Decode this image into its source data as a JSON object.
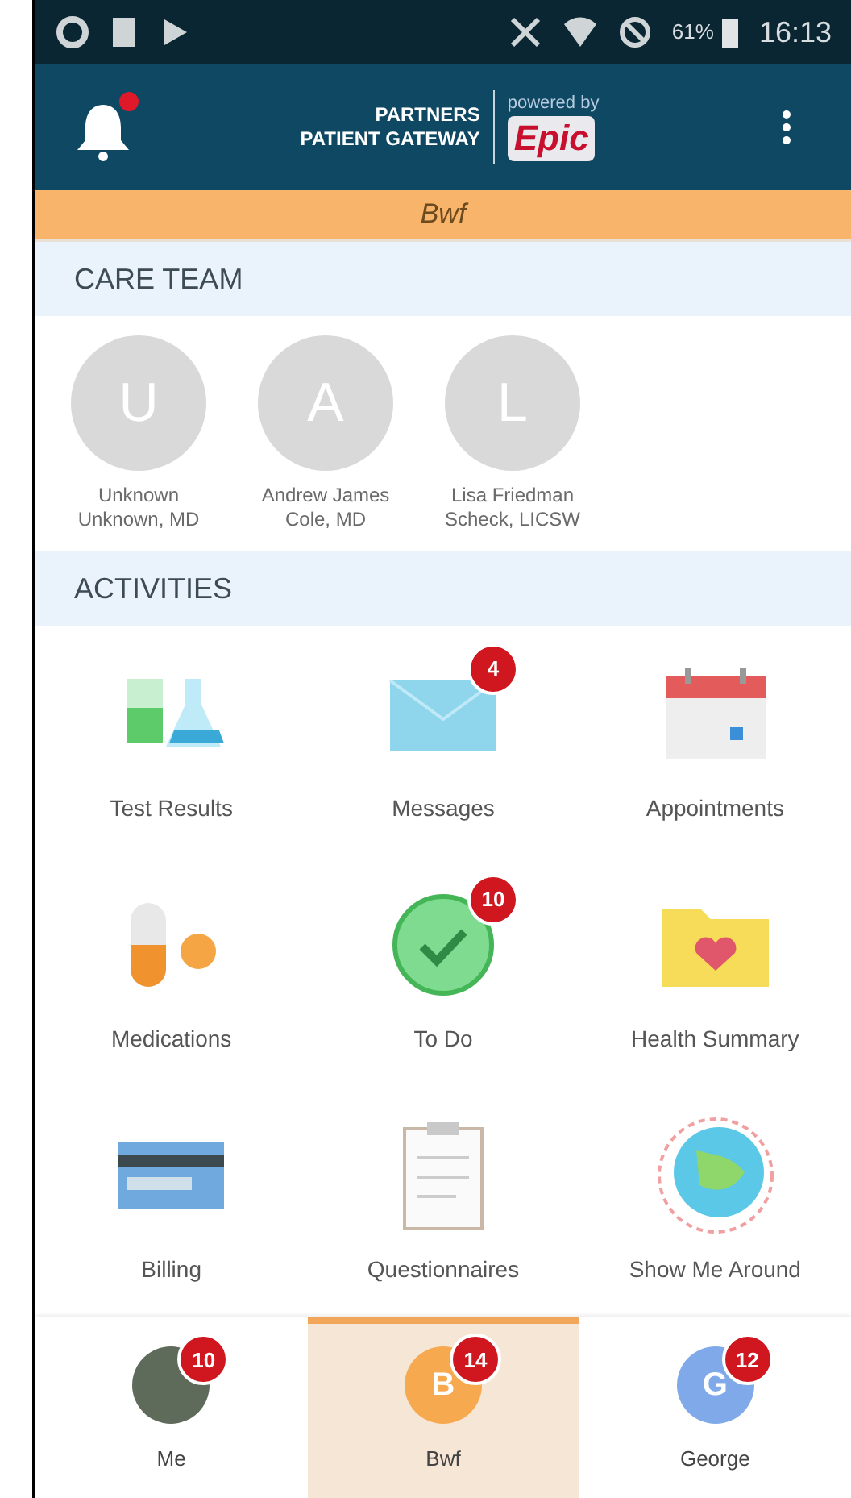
{
  "status_bar": {
    "battery": "61%",
    "time": "16:13"
  },
  "header": {
    "logo_line_1": "PARTNERS",
    "logo_line_2": "PATIENT GATEWAY",
    "powered_by": "powered by",
    "brand": "Epic",
    "notification": true
  },
  "patient_banner": {
    "name": "Bwf"
  },
  "care_team": {
    "title": "CARE TEAM",
    "members": [
      {
        "initial": "U",
        "name_line_1": "Unknown",
        "name_line_2": "Unknown, MD"
      },
      {
        "initial": "A",
        "name_line_1": "Andrew James",
        "name_line_2": "Cole, MD"
      },
      {
        "initial": "L",
        "name_line_1": "Lisa Friedman",
        "name_line_2": "Scheck, LICSW"
      }
    ]
  },
  "activities": {
    "title": "ACTIVITIES",
    "items": [
      {
        "label": "Test Results"
      },
      {
        "label": "Messages",
        "badge": "4"
      },
      {
        "label": "Appointments"
      },
      {
        "label": "Medications"
      },
      {
        "label": "To Do",
        "badge": "10"
      },
      {
        "label": "Health Summary"
      },
      {
        "label": "Billing"
      },
      {
        "label": "Questionnaires"
      },
      {
        "label": "Show Me Around"
      }
    ]
  },
  "bottom_nav": [
    {
      "label": "Me",
      "badge": "10",
      "selected": false,
      "color": "#5f6b5a"
    },
    {
      "label": "Bwf",
      "initial": "B",
      "badge": "14",
      "selected": true,
      "color": "#f7a94f"
    },
    {
      "label": "George",
      "initial": "G",
      "badge": "12",
      "selected": false,
      "color": "#7fa9e8"
    }
  ]
}
